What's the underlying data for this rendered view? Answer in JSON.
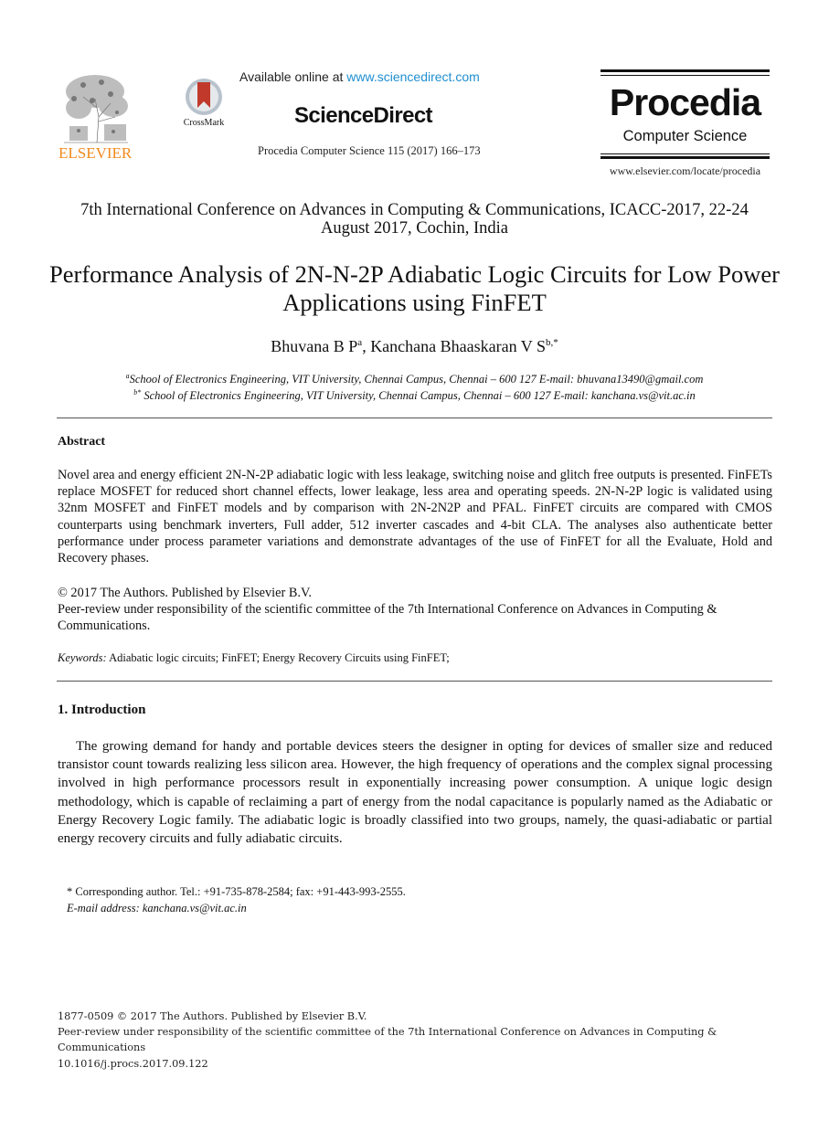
{
  "header": {
    "publisher_logo_text": "ELSEVIER",
    "crossmark_label": "CrossMark",
    "available_prefix": "Available online at ",
    "available_link": "www.sciencedirect.com",
    "platform_logo": "ScienceDirect",
    "journal_reference": "Procedia Computer Science 115 (2017) 166–173",
    "journal_logo_title": "Procedia",
    "journal_logo_subtitle": "Computer Science",
    "journal_url": "www.elsevier.com/locate/procedia",
    "colors": {
      "elsevier_orange": "#f08a1c",
      "link_blue": "#1f8fcf",
      "crossmark_red": "#c0392b"
    }
  },
  "conference": "7th International Conference on Advances in Computing & Communications, ICACC-2017, 22-24 August 2017, Cochin, India",
  "title": "Performance Analysis of 2N-N-2P Adiabatic Logic Circuits for Low Power Applications using FinFET",
  "authors": [
    {
      "name": "Bhuvana B P",
      "sup": "a"
    },
    {
      "name": "Kanchana Bhaaskaran V S",
      "sup": "b,*"
    }
  ],
  "affiliations": [
    {
      "sup": "a",
      "text": "School of Electronics Engineering, VIT University, Chennai Campus, Chennai – 600 127 E-mail: bhuvana13490@gmail.com"
    },
    {
      "sup": "b*",
      "text": " School of Electronics Engineering, VIT University, Chennai Campus, Chennai – 600 127 E-mail: kanchana.vs@vit.ac.in"
    }
  ],
  "abstract": {
    "heading": "Abstract",
    "text": "Novel area and energy efficient 2N-N-2P adiabatic logic with less leakage, switching noise and glitch free outputs is presented. FinFETs replace MOSFET for reduced short channel effects, lower leakage, less area and operating speeds. 2N-N-2P logic is validated using 32nm MOSFET and FinFET models and by comparison with 2N-2N2P and PFAL. FinFET circuits are compared with CMOS counterparts using benchmark inverters, Full adder, 512 inverter cascades and 4-bit CLA. The analyses also authenticate better performance under process parameter variations and demonstrate advantages of the use of FinFET for all the Evaluate, Hold and Recovery phases.",
    "copyright": "© 2017 The Authors. Published by Elsevier B.V.",
    "peer_review": "Peer-review under responsibility of the scientific committee of the 7th International Conference on Advances in Computing & Communications."
  },
  "keywords": {
    "label": "Keywords:",
    "text": " Adiabatic logic circuits; FinFET; Energy Recovery Circuits using FinFET;"
  },
  "introduction": {
    "heading": "1. Introduction",
    "text": "The growing demand for handy and portable devices steers the designer in opting for devices of smaller size and reduced transistor count towards realizing less silicon area. However, the high frequency of operations and the complex signal processing involved in high performance processors result in exponentially increasing power consumption. A unique logic design methodology, which is capable of reclaiming a part of energy from the nodal capacitance is popularly named as the Adiabatic or Energy Recovery Logic family. The adiabatic logic is broadly classified into two groups, namely, the quasi-adiabatic or partial energy recovery circuits and fully adiabatic circuits."
  },
  "footnote": {
    "corresponding": "* Corresponding author. Tel.: +91-735-878-2584; fax: +91-443-993-2555.",
    "email": "E-mail address: kanchana.vs@vit.ac.in"
  },
  "bottom": {
    "issn_line": "1877-0509 © 2017 The Authors. Published by Elsevier B.V.",
    "peer_review_line1": "Peer-review under responsibility of the scientific committee of the 7th International Conference on Advances in Computing &",
    "peer_review_line2": "Communications",
    "doi": "10.1016/j.procs.2017.09.122"
  }
}
